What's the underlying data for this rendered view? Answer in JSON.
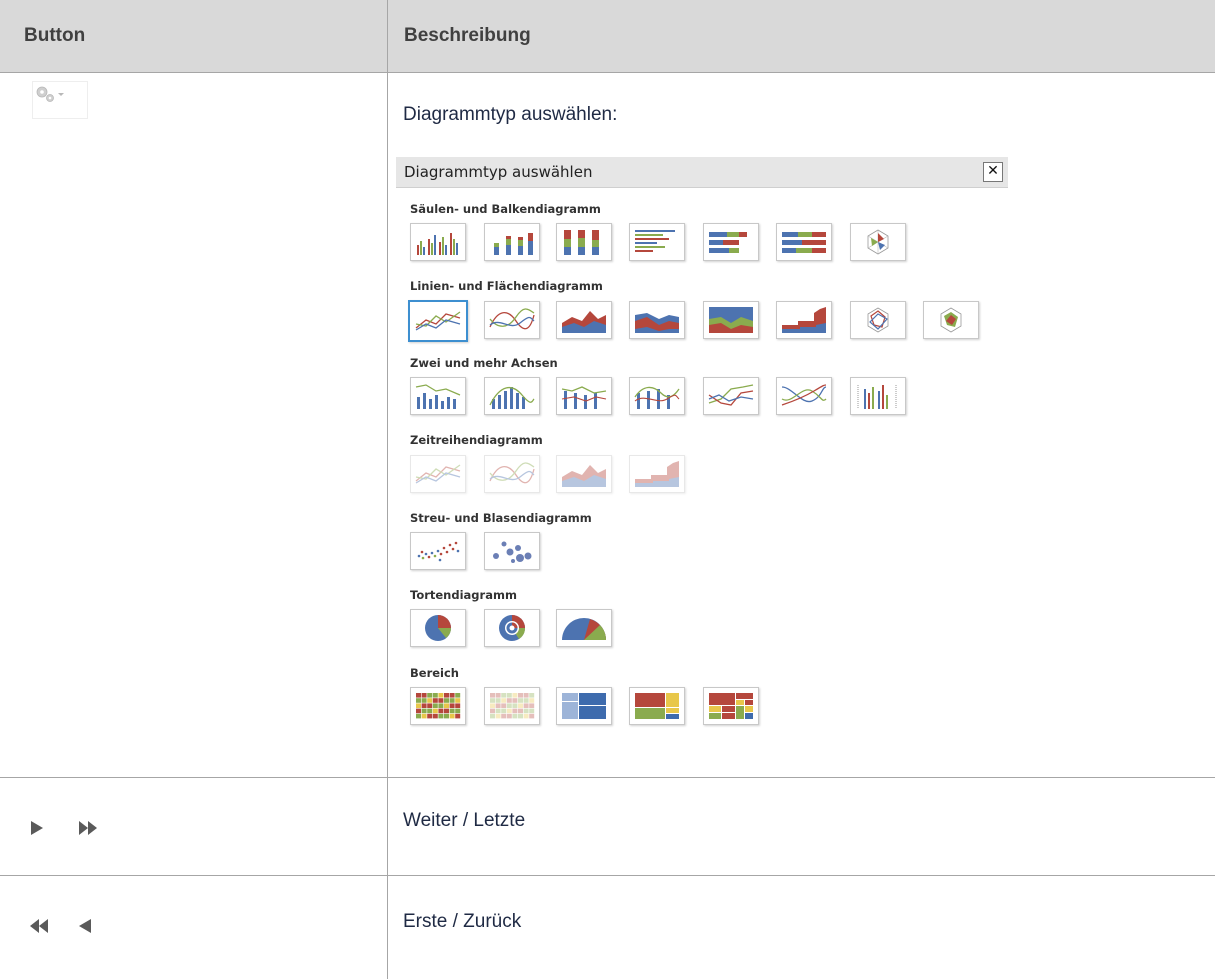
{
  "header": {
    "col_button": "Button",
    "col_description": "Beschreibung"
  },
  "rows": [
    {
      "description": "Diagrammtyp auswählen:",
      "button_icon": "gear-dropdown-icon"
    },
    {
      "description": "Weiter / Letzte",
      "button_icons": [
        "next-icon",
        "last-icon"
      ]
    },
    {
      "description": "Erste / Zurück",
      "button_icons": [
        "first-icon",
        "previous-icon"
      ]
    }
  ],
  "dialog": {
    "title": "Diagrammtyp auswählen",
    "close_icon": "close-icon",
    "sections": [
      {
        "title": "Säulen- und Balkendiagramm",
        "items": [
          "column-chart-icon",
          "stacked-column-chart-icon",
          "stacked-column-100-chart-icon",
          "bar-chart-icon",
          "stacked-bar-chart-icon",
          "stacked-bar-100-chart-icon",
          "radar-bar-chart-icon"
        ]
      },
      {
        "title": "Linien- und Flächendiagramm",
        "items": [
          "line-chart-icon",
          "spline-chart-icon",
          "area-chart-icon",
          "stacked-area-chart-icon",
          "stacked-area-100-chart-icon",
          "step-area-chart-icon",
          "radar-line-chart-icon",
          "radar-area-chart-icon"
        ]
      },
      {
        "title": "Zwei und mehr Achsen",
        "items": [
          "column-line-dual-axis-icon",
          "column-spline-dual-axis-icon",
          "column-line-multi-axis-icon",
          "column-spline-multi-axis-icon",
          "line-multi-axis-icon",
          "spline-multi-axis-icon",
          "column-multi-axis-icon"
        ]
      },
      {
        "title": "Zeitreihendiagramm",
        "items": [
          "time-line-chart-icon",
          "time-spline-chart-icon",
          "time-area-chart-icon",
          "time-step-area-chart-icon"
        ]
      },
      {
        "title": "Streu- und Blasendiagramm",
        "items": [
          "scatter-chart-icon",
          "bubble-chart-icon"
        ]
      },
      {
        "title": "Tortendiagramm",
        "items": [
          "pie-chart-icon",
          "donut-chart-icon",
          "half-pie-chart-icon"
        ]
      },
      {
        "title": "Bereich",
        "items": [
          "heatmap-icon",
          "heatmap-faded-icon",
          "treemap-blue-icon",
          "treemap-color-icon",
          "treemap-nested-icon"
        ]
      }
    ]
  },
  "colors": {
    "red": "#b5473c",
    "green": "#8aab4e",
    "blue": "#4d73b0",
    "yellow": "#e8c74a",
    "selected": "#3d8fd0"
  }
}
